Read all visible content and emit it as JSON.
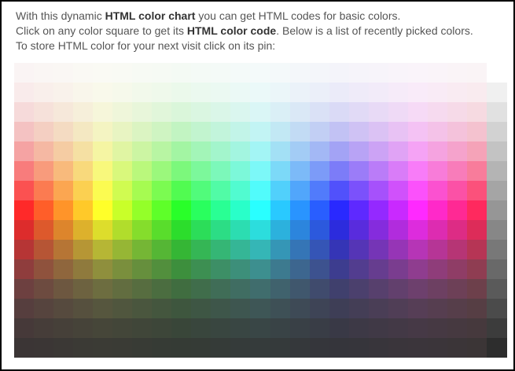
{
  "intro": {
    "line1_pre": "With this dynamic ",
    "line1_bold": "HTML color chart",
    "line1_post": " you can get HTML codes for basic colors.",
    "line2_pre": "Click on any color square to get its ",
    "line2_bold": "HTML color code",
    "line2_post": ". Below is a list of recently picked colors.",
    "line3": "To store HTML color for your next visit click on its pin:"
  },
  "color_chart": {
    "columns": 24,
    "rows": 15,
    "hue_start_deg": 0,
    "hue_step_deg": 15,
    "gray_column_count": 15,
    "swatch_name": "color-swatch",
    "gray_swatch_name": "gray-swatch"
  }
}
